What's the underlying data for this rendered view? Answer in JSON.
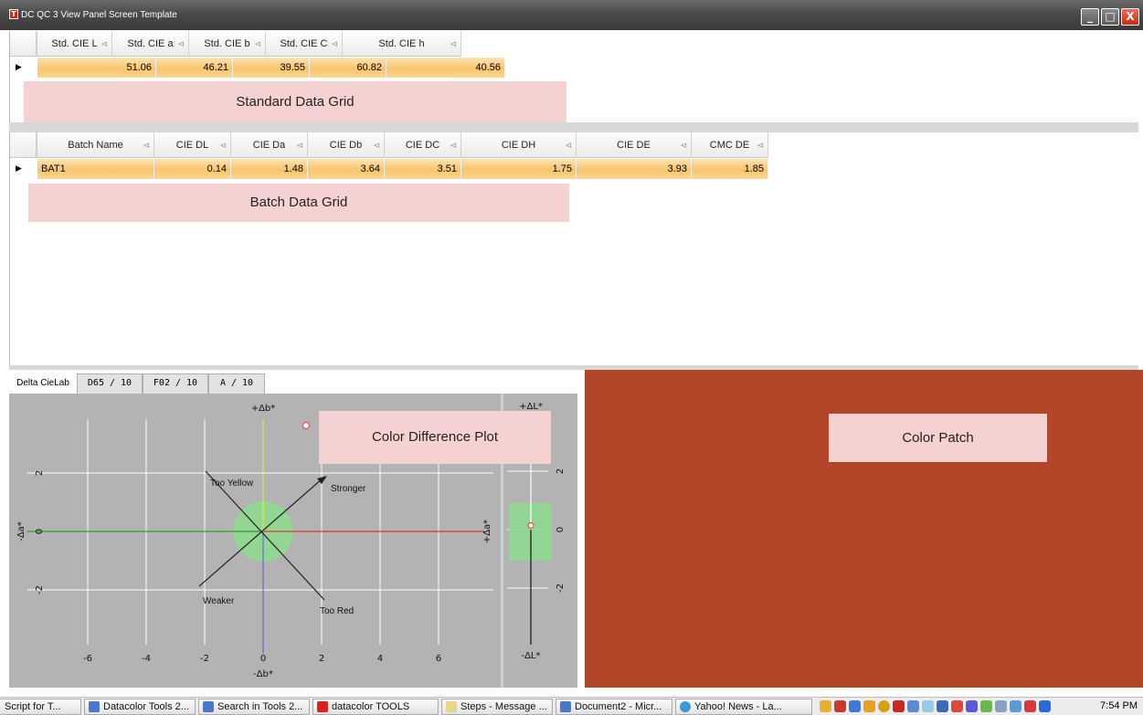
{
  "window": {
    "title": "DC QC 3 View Panel Screen Template",
    "minimize_glyph": "_",
    "maximize_glyph": "□",
    "close_glyph": "X"
  },
  "standard_grid": {
    "columns": [
      "Std. CIE L",
      "Std. CIE a",
      "Std. CIE b",
      "Std. CIE C",
      "Std. CIE h"
    ],
    "row": [
      "51.06",
      "46.21",
      "39.55",
      "60.82",
      "40.56"
    ],
    "label": "Standard Data Grid"
  },
  "batch_grid": {
    "columns": [
      "Batch Name",
      "CIE DL",
      "CIE Da",
      "CIE Db",
      "CIE DC",
      "CIE DH",
      "CIE DE",
      "CMC DE"
    ],
    "row": [
      "BAT1",
      "0.14",
      "1.48",
      "3.64",
      "3.51",
      "1.75",
      "3.93",
      "1.85"
    ],
    "label": "Batch Data Grid"
  },
  "tabs": [
    "Delta CieLab",
    "D65 / 10",
    "F02 / 10",
    "A / 10"
  ],
  "plot": {
    "label": "Color Difference Plot",
    "top_axis": "+Δb*",
    "bottom_axis": "-Δb*",
    "left_axis": "-Δa*",
    "right_axis": "+Δa*",
    "x_ticks": [
      "-6",
      "-4",
      "-2",
      "0",
      "2",
      "4",
      "6"
    ],
    "y_ticks": [
      "2",
      "0",
      "-2"
    ],
    "annotations": {
      "too_yellow": "Too Yellow",
      "stronger": "Stronger",
      "weaker": "Weaker",
      "too_red": "Too Red"
    },
    "point": {
      "da": 1.48,
      "db": 3.64
    },
    "lightness": {
      "top": "+ΔL*",
      "bottom": "-ΔL*",
      "ticks": [
        "2",
        "0",
        "-2"
      ],
      "dl": 0.14
    }
  },
  "color_patch": {
    "label": "Color Patch",
    "color": "#b34628"
  },
  "colors": {
    "green_axis": "#2f9e2f",
    "red_axis": "#d63a3a",
    "yellow_axis": "#e6e63a",
    "blue_axis": "#6a6ad6",
    "tolerance_fill": "#8fd88f"
  },
  "taskbar": {
    "items": [
      "Script for T...",
      "Datacolor Tools 2...",
      "Search in Tools 2...",
      "datacolor TOOLS",
      "Steps - Message ...",
      "Document2 - Micr...",
      "Yahoo! News - La..."
    ],
    "clock": "7:54 PM"
  }
}
